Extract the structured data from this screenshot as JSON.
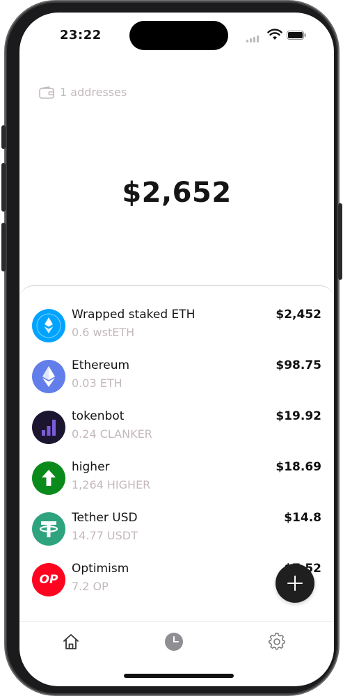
{
  "status_bar": {
    "time": "23:22",
    "icons": [
      "cellular-signal-icon",
      "wifi-icon",
      "battery-icon"
    ]
  },
  "header": {
    "addresses_icon": "wallet-icon",
    "addresses_label": "1 addresses"
  },
  "portfolio": {
    "total_balance": "$2,652"
  },
  "tokens": [
    {
      "name": "Wrapped staked ETH",
      "amount": "0.6 wstETH",
      "value": "$2,452",
      "icon": "wsteth-logo-icon",
      "color": "#00a3ff"
    },
    {
      "name": "Ethereum",
      "amount": "0.03 ETH",
      "value": "$98.75",
      "icon": "ethereum-logo-icon",
      "color": "#627eea"
    },
    {
      "name": "tokenbot",
      "amount": "0.24 CLANKER",
      "value": "$19.92",
      "icon": "tokenbot-logo-icon",
      "color": "#1b1530"
    },
    {
      "name": "higher",
      "amount": "1,264 HIGHER",
      "value": "$18.69",
      "icon": "higher-arrow-logo-icon",
      "color": "#0b8a1c"
    },
    {
      "name": "Tether USD",
      "amount": "14.77 USDT",
      "value": "$14.8",
      "icon": "tether-logo-icon",
      "color": "#2ea37e"
    },
    {
      "name": "Optimism",
      "amount": "7.2 OP",
      "value": "$7.52",
      "icon": "optimism-logo-icon",
      "logo_text": "OP",
      "color": "#ff0420"
    }
  ],
  "fab": {
    "icon": "plus-icon"
  },
  "bottom_nav": [
    {
      "id": "home",
      "icon": "home-icon"
    },
    {
      "id": "history",
      "icon": "clock-icon"
    },
    {
      "id": "settings",
      "icon": "gear-icon"
    }
  ]
}
